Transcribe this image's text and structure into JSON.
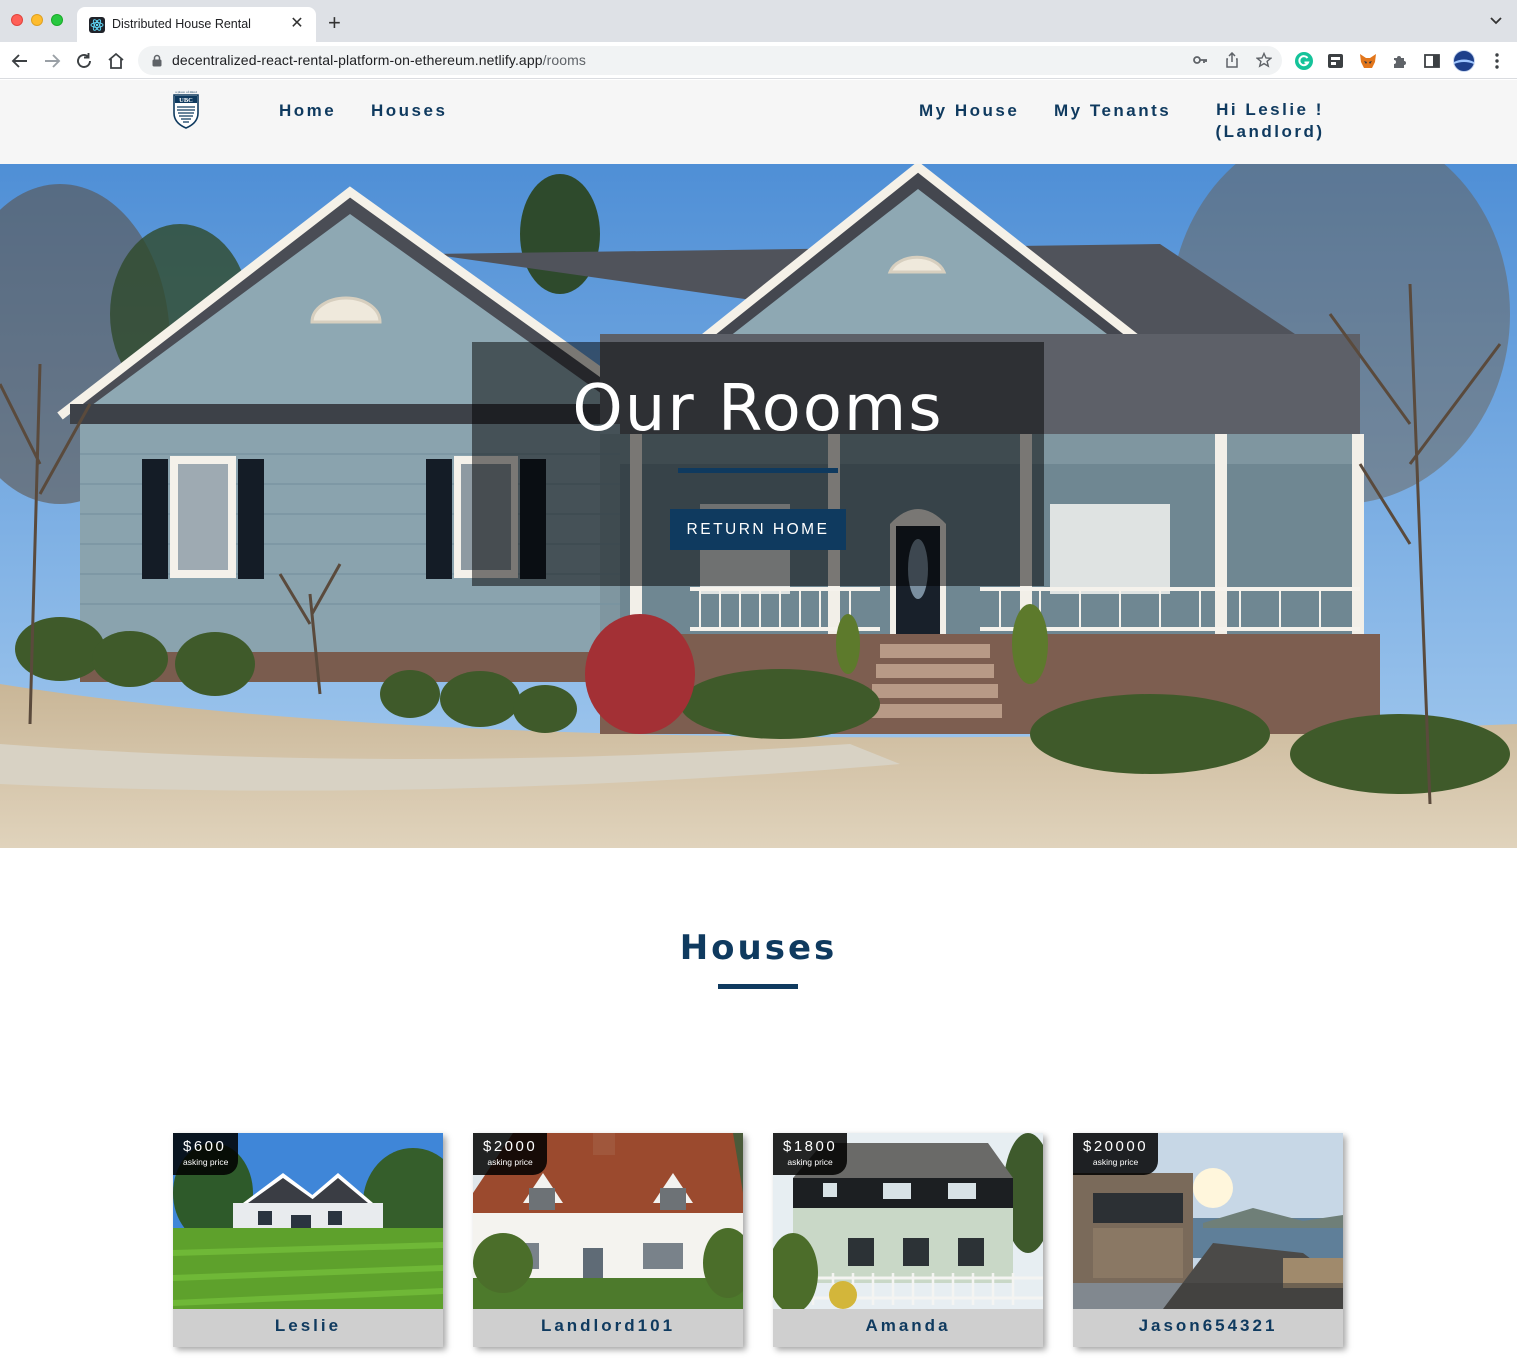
{
  "browser": {
    "tab_title": "Distributed House Rental",
    "tab_close": "✕",
    "new_tab": "+",
    "url_host": "decentralized-react-rental-platform-on-ethereum.netlify.app",
    "url_path": "/rooms"
  },
  "nav": {
    "logo_text": "UBC",
    "links": [
      "Home",
      "Houses"
    ],
    "right_links": [
      "My House",
      "My Tenants"
    ],
    "user_line1": "Hi Leslie !",
    "user_line2": "(Landlord)"
  },
  "hero": {
    "title": "Our Rooms",
    "button": "RETURN HOME"
  },
  "section": {
    "title": "Houses"
  },
  "houses": [
    {
      "price": "$600",
      "price_label": "asking price",
      "owner": "Leslie"
    },
    {
      "price": "$2000",
      "price_label": "asking price",
      "owner": "Landlord101"
    },
    {
      "price": "$1800",
      "price_label": "asking price",
      "owner": "Amanda"
    },
    {
      "price": "$20000",
      "price_label": "asking price",
      "owner": "Jason654321"
    }
  ],
  "colors": {
    "brand": "#0f3a5f",
    "nav_bg": "#f6f6f6",
    "card_bg": "#cfcfcf"
  }
}
